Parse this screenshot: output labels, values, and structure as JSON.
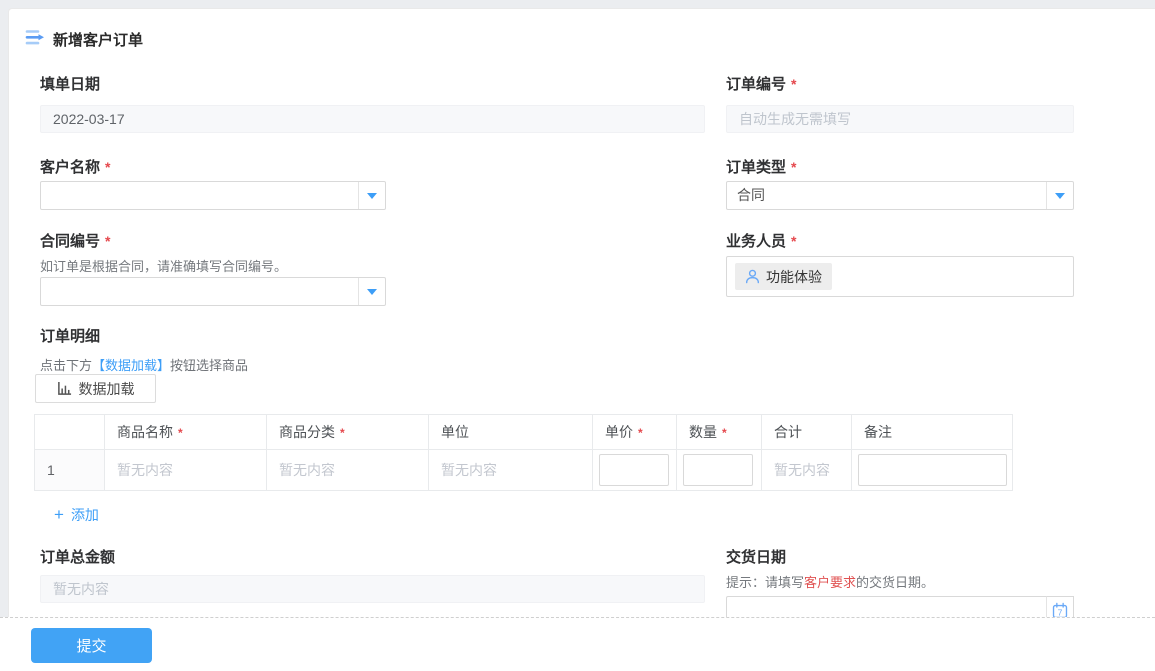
{
  "colors": {
    "accent": "#3d9ef7",
    "submit": "#41a3f5",
    "required": "#e5484d",
    "hint_red": "#e05252"
  },
  "header": {
    "title": "新增客户订单"
  },
  "fields": {
    "fill_date": {
      "label": "填单日期",
      "value": "2022-03-17"
    },
    "order_no": {
      "label": "订单编号",
      "required": "*",
      "placeholder": "自动生成无需填写"
    },
    "customer": {
      "label": "客户名称",
      "required": "*",
      "value": ""
    },
    "order_type": {
      "label": "订单类型",
      "required": "*",
      "value": "合同"
    },
    "contract_no": {
      "label": "合同编号",
      "required": "*",
      "help": "如订单是根据合同，请准确填写合同编号。",
      "value": ""
    },
    "salesperson": {
      "label": "业务人员",
      "required": "*",
      "tag": "功能体验"
    },
    "order_total": {
      "label": "订单总金额",
      "placeholder": "暂无内容"
    },
    "delivery_date": {
      "label": "交货日期",
      "hint_prefix": "提示：请填写",
      "hint_em": "客户要求",
      "hint_suffix": "的交货日期。",
      "value": ""
    }
  },
  "detail": {
    "label": "订单明细",
    "help_prefix": "点击下方",
    "help_em": "【数据加载】",
    "help_suffix": "按钮选择商品",
    "load_button_label": "数据加载",
    "add_icon": "+",
    "add_label": "添加",
    "table": {
      "columns": [
        {
          "label": "",
          "required": ""
        },
        {
          "label": "商品名称",
          "required": "*"
        },
        {
          "label": "商品分类",
          "required": "*"
        },
        {
          "label": "单位",
          "required": ""
        },
        {
          "label": "单价",
          "required": "*"
        },
        {
          "label": "数量",
          "required": "*"
        },
        {
          "label": "合计",
          "required": ""
        },
        {
          "label": "备注",
          "required": ""
        }
      ],
      "row": {
        "index": "1",
        "product_name_placeholder": "暂无内容",
        "category_placeholder": "暂无内容",
        "unit_placeholder": "暂无内容",
        "unit_price_value": "",
        "quantity_value": "",
        "total_placeholder": "暂无内容",
        "remark_value": ""
      }
    }
  },
  "footer": {
    "submit_label": "提交"
  },
  "icons": {
    "menu": "menu-lines-arrow",
    "person": "person-outline",
    "chart": "bar-chart",
    "calendar": "calendar-7",
    "dropdown": "triangle-down"
  }
}
